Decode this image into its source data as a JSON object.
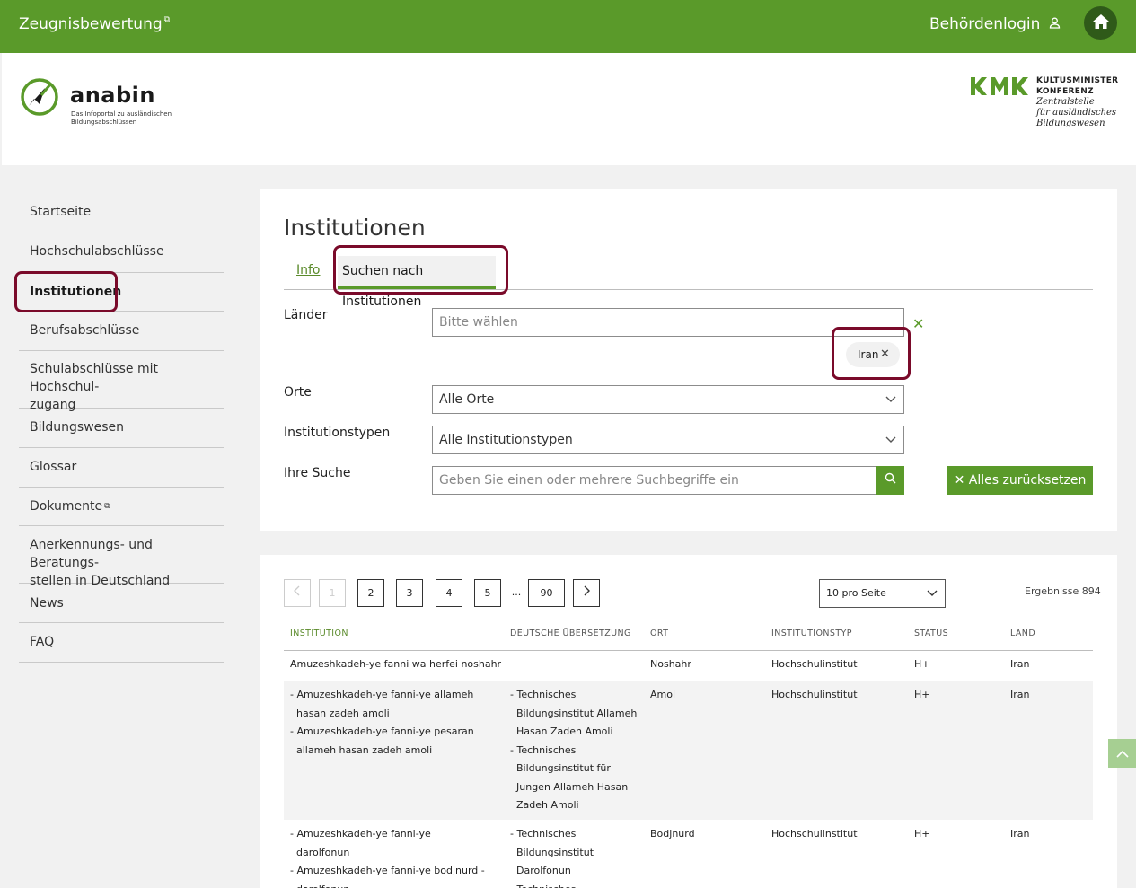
{
  "topbar": {
    "brand": "Zeugnisbewertung",
    "login": "Behördenlogin",
    "colors": {
      "bar": "#5a9a2a",
      "home": "#2f5a19"
    }
  },
  "header": {
    "logo_name": "anabin",
    "logo_tag": "Das Infoportal zu ausländischen Bildungsabschlüssen",
    "kmk_line1": "KULTUSMINISTER",
    "kmk_line2": "KONFERENZ",
    "kmk_line3": "Zentralstelle",
    "kmk_line4": "für ausländisches",
    "kmk_line5": "Bildungswesen"
  },
  "sidebar": {
    "items": [
      {
        "label": "Startseite"
      },
      {
        "label": "Hochschulabschlüsse"
      },
      {
        "label": "Institutionen"
      },
      {
        "label": "Berufsabschlüsse"
      },
      {
        "label": "Schulabschlüsse mit Hochschul-",
        "label2": "zugang"
      },
      {
        "label": "Bildungswesen"
      },
      {
        "label": "Glossar"
      },
      {
        "label": "Dokumente"
      },
      {
        "label": "Anerkennungs- und Beratungs-",
        "label2": "stellen in Deutschland"
      },
      {
        "label": "News"
      },
      {
        "label": "FAQ"
      }
    ],
    "active": "Institutionen"
  },
  "search_panel": {
    "title": "Institutionen",
    "tabs": [
      {
        "label": "Info"
      },
      {
        "label": "Suchen nach Institutionen",
        "active": true
      }
    ],
    "fields": {
      "laender": {
        "label": "Länder",
        "placeholder": "Bitte wählen",
        "chip": "Iran"
      },
      "orte": {
        "label": "Orte",
        "value": "Alle Orte"
      },
      "typen": {
        "label": "Institutionstypen",
        "value": "Alle Institutionstypen"
      },
      "suche": {
        "label": "Ihre Suche",
        "placeholder": "Geben Sie einen oder mehrere Suchbegriffe ein"
      }
    },
    "reset_label": "Alles zurücksetzen"
  },
  "results": {
    "pagination": {
      "pages": [
        "1",
        "2",
        "3",
        "4",
        "5"
      ],
      "ellipsis": "...",
      "last": "90",
      "current": "1"
    },
    "per_page": "10 pro Seite",
    "count": "Ergebnisse 894",
    "columns": [
      "INSTITUTION",
      "DEUTSCHE ÜBERSETZUNG",
      "ORT",
      "INSTITUTIONSTYP",
      "STATUS",
      "LAND"
    ],
    "rows": [
      {
        "institution": [
          "Amuzeshkadeh-ye fanni wa herfei noshahr"
        ],
        "translation": [],
        "ort": "Noshahr",
        "typ": "Hochschulinstitut",
        "status": "H+",
        "land": "Iran"
      },
      {
        "institution": [
          "- Amuzeshkadeh-ye fanni-ye allameh hasan zadeh amoli",
          "- Amuzeshkadeh-ye fanni-ye pesaran allameh hasan zadeh amoli"
        ],
        "translation": [
          "- Technisches Bildungsinstitut Allameh Hasan Zadeh Amoli",
          "- Technisches Bildungsinstitut für Jungen Allameh Hasan Zadeh Amoli"
        ],
        "ort": "Amol",
        "typ": "Hochschulinstitut",
        "status": "H+",
        "land": "Iran"
      },
      {
        "institution": [
          "- Amuzeshkadeh-ye fanni-ye darolfonun",
          "- Amuzeshkadeh-ye fanni-ye bodjnurd - darolfonun"
        ],
        "translation": [
          "- Technisches Bildungsinstitut Darolfonun",
          "- Technisches"
        ],
        "ort": "Bodjnurd",
        "typ": "Hochschulinstitut",
        "status": "H+",
        "land": "Iran"
      }
    ]
  }
}
